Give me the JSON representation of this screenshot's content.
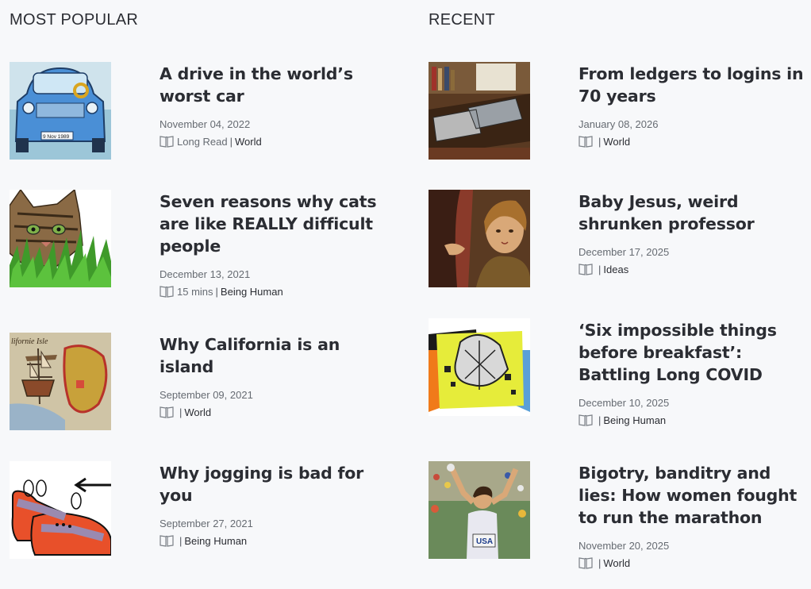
{
  "sections": {
    "popular": {
      "heading": "MOST POPULAR",
      "items": [
        {
          "title": "A drive in the world’s worst car",
          "date": "November 04, 2022",
          "readtime": "Long Read",
          "category": "World",
          "image": "car-illustration"
        },
        {
          "title": "Seven reasons why cats are like REALLY difficult people",
          "date": "December 13, 2021",
          "readtime": "15 mins",
          "category": "Being Human",
          "image": "cat-illustration"
        },
        {
          "title": "Why California is an island",
          "date": "September 09, 2021",
          "readtime": "",
          "category": "World",
          "image": "old-map"
        },
        {
          "title": "Why jogging is bad for you",
          "date": "September 27, 2021",
          "readtime": "",
          "category": "Being Human",
          "image": "shoes-illustration"
        }
      ]
    },
    "recent": {
      "heading": "RECENT",
      "items": [
        {
          "title": "From ledgers to logins in 70 years",
          "date": "January 08, 2026",
          "readtime": "",
          "category": "World",
          "image": "ledgers-photo"
        },
        {
          "title": "Baby Jesus, weird shrunken professor",
          "date": "December 17, 2025",
          "readtime": "",
          "category": "Ideas",
          "image": "painting-detail"
        },
        {
          "title": "‘Six impossible things before breakfast’: Battling Long COVID",
          "date": "December 10, 2025",
          "readtime": "",
          "category": "Being Human",
          "image": "collage-illustration"
        },
        {
          "title": "Bigotry, banditry and lies:  How women fought to run the marathon",
          "date": "November 20, 2025",
          "readtime": "",
          "category": "World",
          "image": "runner-photo"
        }
      ]
    }
  },
  "thumb_text": {
    "car_plate": "9 Nov 1989",
    "map_label": "lifornie Isle",
    "runner_bib": "USA"
  }
}
